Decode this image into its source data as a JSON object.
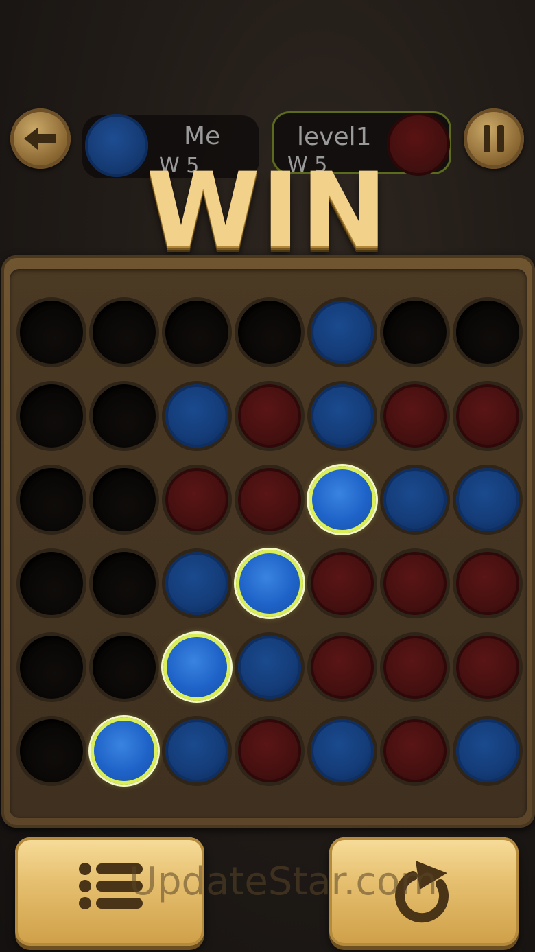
{
  "header": {
    "player1": {
      "name": "Me",
      "stat": "W 5",
      "color": "blue"
    },
    "player2": {
      "name": "level1",
      "stat": "W 5",
      "color": "red"
    }
  },
  "result": {
    "title": "WIN"
  },
  "board": {
    "rows": [
      [
        "empty",
        "empty",
        "empty",
        "empty",
        "blue",
        "empty",
        "empty"
      ],
      [
        "empty",
        "empty",
        "blue",
        "red",
        "blue",
        "red",
        "red"
      ],
      [
        "empty",
        "empty",
        "red",
        "red",
        "win",
        "blue",
        "blue"
      ],
      [
        "empty",
        "empty",
        "blue",
        "win",
        "red",
        "red",
        "red"
      ],
      [
        "empty",
        "empty",
        "win",
        "blue",
        "red",
        "red",
        "red"
      ],
      [
        "empty",
        "win",
        "blue",
        "red",
        "blue",
        "red",
        "blue"
      ]
    ]
  },
  "controls": {
    "back_icon": "arrow-left-icon",
    "pause_icon": "pause-icon",
    "menu_icon": "menu-list-icon",
    "restart_icon": "restart-icon"
  },
  "watermark": "UpdateStar.com",
  "colors": {
    "blue_disc": "#143c78",
    "red_disc": "#461010",
    "win_highlight": "#d9ee58",
    "title_gold": "#f2d18a"
  }
}
